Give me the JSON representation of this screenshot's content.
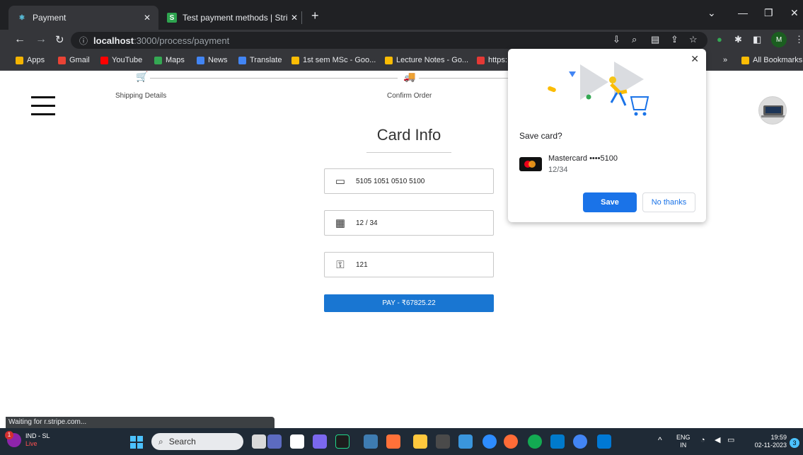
{
  "browser": {
    "tabs": [
      {
        "title": "Payment",
        "active": true
      },
      {
        "title": "Test payment methods | Stripe D",
        "active": false
      }
    ],
    "new_tab_symbol": "+",
    "url_host": "localhost",
    "url_path": ":3000/process/payment",
    "profile_initial": "M",
    "status_text": "Waiting for r.stripe.com...",
    "bookmarks": [
      {
        "label": "Apps",
        "color": "#f4b400"
      },
      {
        "label": "Gmail",
        "color": "#ea4335"
      },
      {
        "label": "YouTube",
        "color": "#ff0000"
      },
      {
        "label": "Maps",
        "color": "#34a853"
      },
      {
        "label": "News",
        "color": "#4285f4"
      },
      {
        "label": "Translate",
        "color": "#4285f4"
      },
      {
        "label": "1st sem MSc - Goo...",
        "color": "#fbbc04"
      },
      {
        "label": "Lecture Notes - Go...",
        "color": "#fbbc04"
      },
      {
        "label": "https:",
        "color": "#e53935"
      }
    ],
    "bookmarks_overflow": "»",
    "all_bookmarks": "All Bookmarks"
  },
  "page": {
    "steps": [
      {
        "label": "Shipping Details",
        "icon": "cart-icon"
      },
      {
        "label": "Confirm Order",
        "icon": "truck-icon"
      }
    ],
    "title": "Card Info",
    "card_number": "5105 1051 0510 5100",
    "expiry": "12 / 34",
    "cvc": "121",
    "pay_label": "PAY - ₹67825.22",
    "accent": "#1976d2"
  },
  "save_card_popup": {
    "title": "Save card?",
    "card_brand": "Mastercard",
    "card_masked": "Mastercard ••••5100",
    "card_expiry": "12/34",
    "save_label": "Save",
    "no_thanks_label": "No thanks"
  },
  "taskbar": {
    "weather_badge": "1",
    "weather_line1": "IND - SL",
    "weather_line2": "Live",
    "search_placeholder": "Search",
    "lang_line1": "ENG",
    "lang_line2": "IN",
    "time": "19:59",
    "date": "02-11-2023",
    "notification_count": "3"
  }
}
